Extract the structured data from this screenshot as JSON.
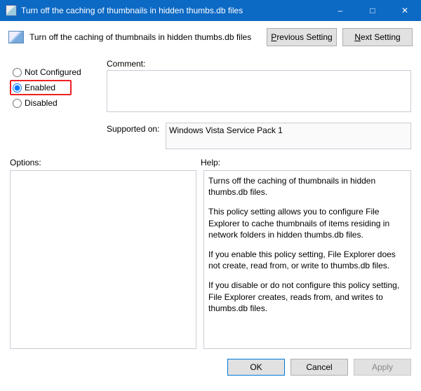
{
  "window": {
    "title": "Turn off the caching of thumbnails in hidden thumbs.db files"
  },
  "header": {
    "policy_title": "Turn off the caching of thumbnails in hidden thumbs.db files",
    "prev_label": "Previous Setting",
    "next_label": "Next Setting"
  },
  "state": {
    "not_configured": "Not Configured",
    "enabled": "Enabled",
    "disabled": "Disabled",
    "selected": "enabled"
  },
  "labels": {
    "comment": "Comment:",
    "supported_on": "Supported on:",
    "options": "Options:",
    "help": "Help:"
  },
  "supported_on_value": "Windows Vista Service Pack 1",
  "help": {
    "p1": "Turns off the caching of thumbnails in hidden thumbs.db files.",
    "p2": "This policy setting allows you to configure File Explorer to cache thumbnails of items residing in network folders in hidden thumbs.db files.",
    "p3": "If you enable this policy setting, File Explorer does not create, read from, or write to thumbs.db files.",
    "p4": "If you disable or do not configure this policy setting, File Explorer creates, reads from, and writes to thumbs.db files."
  },
  "footer": {
    "ok": "OK",
    "cancel": "Cancel",
    "apply": "Apply"
  }
}
